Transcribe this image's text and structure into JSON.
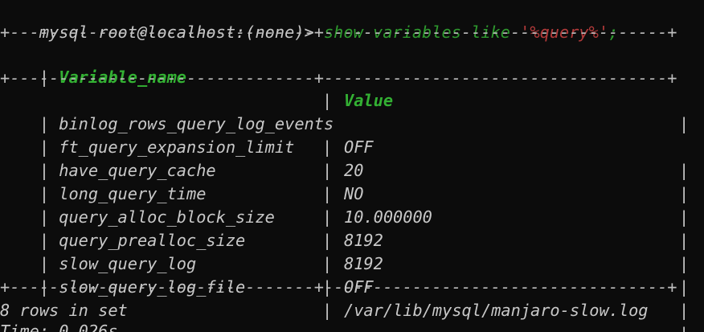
{
  "prompt": "mysql root@localhost:(none)> ",
  "command": {
    "keyword": "show variables like ",
    "string": "'%query%'",
    "terminator": ";"
  },
  "table": {
    "border_line": "+-------------------------------+-----------------------------------+",
    "headers": [
      "Variable_name",
      "Value"
    ],
    "rows": [
      [
        "binlog_rows_query_log_events",
        "OFF"
      ],
      [
        "ft_query_expansion_limit",
        "20"
      ],
      [
        "have_query_cache",
        "NO"
      ],
      [
        "long_query_time",
        "10.000000"
      ],
      [
        "query_alloc_block_size",
        "8192"
      ],
      [
        "query_prealloc_size",
        "8192"
      ],
      [
        "slow_query_log",
        "OFF"
      ],
      [
        "slow_query_log_file",
        "/var/lib/mysql/manjaro-slow.log"
      ]
    ]
  },
  "footer": {
    "rows_text": "8 rows in set",
    "time_text": "Time: 0.026s"
  },
  "colors": {
    "background": "#0c0c0c",
    "text": "#c8c8c8",
    "keyword": "#2e9a2e",
    "string": "#b23a3a",
    "header": "#33b033"
  }
}
